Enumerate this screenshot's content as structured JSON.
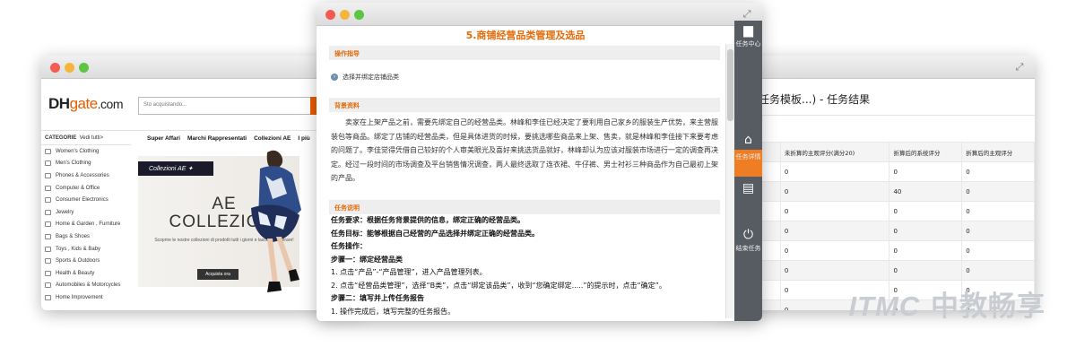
{
  "left_window": {
    "logo": {
      "dh": "DH",
      "gate": "gate",
      "com": ".com"
    },
    "search_placeholder": "Sto acquistando...",
    "categories_head": {
      "label": "CATEGORIE",
      "sub": "Vedi tutti>"
    },
    "categories": [
      "Women's Clothing",
      "Men's Clothing",
      "Phones & Accessories",
      "Computer & Office",
      "Consumer Electronics",
      "Jewelry",
      "Home & Garden , Furniture",
      "Bags & Shoes",
      "Toys , Kids & Baby",
      "Sports & Outdoors",
      "Health & Beauty",
      "Automobiles & Motorcycles",
      "Home Improvement"
    ],
    "nav": [
      "Super Affari",
      "Marchi Rappresentati",
      "Collezioni AE",
      "I più"
    ],
    "banner": {
      "tag": "Collezioni AE ✦",
      "title": "AE COLLEZIONI",
      "subtitle": "Scoprire le nostre collezioni di prodotti tutti i giorni e lasciatevi ispirare!",
      "button": "Acquista ora"
    }
  },
  "center_window": {
    "title": "5.商铺经营品类管理及选品",
    "sections": {
      "guide": "操作指导",
      "background": "背景资料",
      "task": "任务说明"
    },
    "guide_item": "选择并绑定店铺品类",
    "background_text": "卖家在上架产品之前，需要先绑定自己的经营品类。林峰和李佳已经决定了要利用自己家乡的服装生产优势，来主营服装包等商品。绑定了店铺的经营品类，但是具体进货的时候，要挑选哪些商品来上架、售卖，就是林峰和李佳接下来要考虑的问题了。李佳觉得凭借自己较好的个人审美眼光及喜好来挑选货品就好，林峰却认为应该对服装市场进行一定的调查再决定。经过一段时间的市场调查及平台销售情况调查，两人最终选取了连衣裙、牛仔裤、男士衬衫三种商品作为自己最初上架的产品。",
    "task_lines": [
      {
        "bold": true,
        "text": "任务要求：根据任务背景提供的信息，绑定正确的经营品类。"
      },
      {
        "bold": true,
        "text": "任务目标：能够根据自己经营的产品选择并绑定正确的经营品类。"
      },
      {
        "bold": true,
        "text": "任务操作："
      },
      {
        "bold": true,
        "text": "步骤一：绑定经营品类"
      },
      {
        "bold": false,
        "text": "1. 点击“产品”-“产品管理”，进入产品管理列表。"
      },
      {
        "bold": false,
        "text": "2. 点击“经营品类管理”，选择“B类”，点击“绑定该品类”，收到“您确定绑定.....”的提示时，点击“确定”。"
      },
      {
        "bold": true,
        "text": "步骤二：填写并上传任务报告"
      },
      {
        "bold": false,
        "text": "1. 操作完成后，填写完整的任务报告。"
      }
    ],
    "sidebar": [
      {
        "icon": "▆",
        "label": "任务中心",
        "active": false
      },
      {
        "icon": "⌂",
        "label": "",
        "active": false
      },
      {
        "icon": "",
        "label": "任务详情",
        "active": true
      },
      {
        "icon": "▤",
        "label": "",
        "active": false
      },
      {
        "icon": "⏻",
        "label": "结束任务",
        "active": false
      }
    ]
  },
  "right_window": {
    "title": "任务模板...) - 任务结果",
    "table": {
      "headers": [
        "",
        "未折算的主观评分(满分20)",
        "折算后的系统评分",
        "折算后的主观评分"
      ],
      "rows": [
        [
          "",
          "0",
          "0",
          "0"
        ],
        [
          "",
          "0",
          "40",
          "0"
        ],
        [
          "",
          "0",
          "0",
          "0"
        ],
        [
          "",
          "0",
          "0",
          "0"
        ],
        [
          "",
          "0",
          "0",
          "0"
        ],
        [
          "",
          "0",
          "0",
          "0"
        ],
        [
          "",
          "0",
          "0",
          "0"
        ],
        [
          "",
          "0",
          "0",
          "0"
        ]
      ]
    }
  },
  "watermark": {
    "itmc": "ITMC",
    "cn": "中教畅享"
  }
}
